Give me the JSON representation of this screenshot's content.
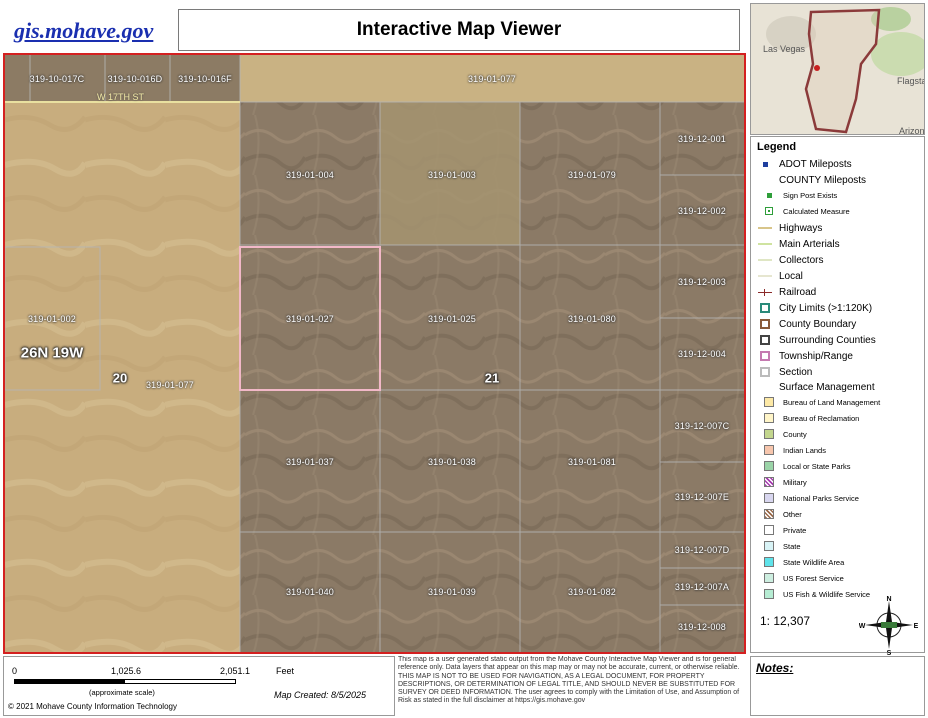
{
  "header": {
    "site_link": "gis.mohave.gov",
    "title": "Interactive Map Viewer"
  },
  "map": {
    "parcels": [
      {
        "id": "319-10-017C"
      },
      {
        "id": "319-10-016D"
      },
      {
        "id": "319-10-016F"
      },
      {
        "id": "319-01-077"
      },
      {
        "id": "319-12-001"
      },
      {
        "id": "319-01-004"
      },
      {
        "id": "319-01-003"
      },
      {
        "id": "319-01-079"
      },
      {
        "id": "319-12-002"
      },
      {
        "id": "319-12-003"
      },
      {
        "id": "319-01-002"
      },
      {
        "id": "319-01-027"
      },
      {
        "id": "319-01-025"
      },
      {
        "id": "319-01-080"
      },
      {
        "id": "319-12-004"
      },
      {
        "id": "319-01-077"
      },
      {
        "id": "319-12-007C"
      },
      {
        "id": "319-01-037"
      },
      {
        "id": "319-01-038"
      },
      {
        "id": "319-01-081"
      },
      {
        "id": "319-12-007E"
      },
      {
        "id": "319-12-007D"
      },
      {
        "id": "319-01-040"
      },
      {
        "id": "319-01-039"
      },
      {
        "id": "319-01-082"
      },
      {
        "id": "319-12-007A"
      },
      {
        "id": "319-12-008"
      }
    ],
    "street": "W 17TH ST",
    "township": "26N 19W",
    "sections": [
      "20",
      "21"
    ]
  },
  "overview": {
    "labels": [
      "Las Vegas",
      "Flagsta",
      "Arizon"
    ]
  },
  "legend": {
    "title": "Legend",
    "items": [
      {
        "label": "ADOT Mileposts",
        "size": "normal",
        "symbol": "dot",
        "color": "#1f3f9f"
      },
      {
        "label": "COUNTY Mileposts",
        "size": "normal",
        "symbol": "none",
        "color": ""
      },
      {
        "label": "Sign Post Exists",
        "size": "small",
        "symbol": "dot",
        "color": "#2e9e3a"
      },
      {
        "label": "Calculated Measure",
        "size": "small",
        "symbol": "dotbox",
        "color": "#2e9e3a"
      },
      {
        "label": "Highways",
        "size": "normal",
        "symbol": "line",
        "color": "#d8c58a"
      },
      {
        "label": "Main Arterials",
        "size": "normal",
        "symbol": "line",
        "color": "#cfe3a0"
      },
      {
        "label": "Collectors",
        "size": "normal",
        "symbol": "line",
        "color": "#dfe6c4"
      },
      {
        "label": "Local",
        "size": "normal",
        "symbol": "line",
        "color": "#e6e6d0"
      },
      {
        "label": "Railroad",
        "size": "normal",
        "symbol": "rail",
        "color": "#8b2a2a"
      },
      {
        "label": "City Limits (>1:120K)",
        "size": "normal",
        "symbol": "box",
        "color": "#2a8a7a"
      },
      {
        "label": "County Boundary",
        "size": "normal",
        "symbol": "box",
        "color": "#8a5a3a"
      },
      {
        "label": "Surrounding Counties",
        "size": "normal",
        "symbol": "box",
        "color": "#444444"
      },
      {
        "label": "Township/Range",
        "size": "normal",
        "symbol": "box",
        "color": "#c57ab0"
      },
      {
        "label": "Section",
        "size": "normal",
        "symbol": "box",
        "color": "#bbbbbb"
      },
      {
        "label": "Surface Management",
        "size": "normal",
        "symbol": "none",
        "color": ""
      },
      {
        "label": "Bureau of Land Management",
        "size": "small",
        "symbol": "swatch",
        "color": "#fde9a6"
      },
      {
        "label": "Bureau of Reclamation",
        "size": "small",
        "symbol": "swatch",
        "color": "#fff5c8"
      },
      {
        "label": "County",
        "size": "small",
        "symbol": "swatch",
        "color": "#c3d68e"
      },
      {
        "label": "Indian Lands",
        "size": "small",
        "symbol": "swatch",
        "color": "#f7c6ad"
      },
      {
        "label": "Local or State Parks",
        "size": "small",
        "symbol": "swatch",
        "color": "#9bd4a8"
      },
      {
        "label": "Military",
        "size": "small",
        "symbol": "hatch",
        "color": "#a73ab0"
      },
      {
        "label": "National Parks Service",
        "size": "small",
        "symbol": "swatch",
        "color": "#d8d6ef"
      },
      {
        "label": "Other",
        "size": "small",
        "symbol": "hatch",
        "color": "#9a6a4a"
      },
      {
        "label": "Private",
        "size": "small",
        "symbol": "swatch",
        "color": "#ffffff"
      },
      {
        "label": "State",
        "size": "small",
        "symbol": "swatch",
        "color": "#d8f3f6"
      },
      {
        "label": "State Wildlife Area",
        "size": "small",
        "symbol": "swatch",
        "color": "#5fe3ea"
      },
      {
        "label": "US Forest Service",
        "size": "small",
        "symbol": "swatch",
        "color": "#cdeee0"
      },
      {
        "label": "US Fish & Wildlife Service",
        "size": "small",
        "symbol": "swatch",
        "color": "#b6ecd3"
      }
    ],
    "scale": "1: 12,307",
    "compass": {
      "n": "N",
      "s": "S",
      "e": "E",
      "w": "W"
    }
  },
  "scalebar": {
    "ticks": [
      "0",
      "1,025.6",
      "2,051.1"
    ],
    "unit": "Feet",
    "note": "(approximate scale)",
    "copyright": "© 2021 Mohave County Information Technology",
    "map_created": "Map Created: 8/5/2025"
  },
  "disclaimer": "This map is a user generated static output from the Mohave County Interactive Map Viewer and is for general reference only. Data layers that appear on this map may or may not be accurate, current, or otherwise reliable. THIS MAP IS NOT TO BE USED FOR NAVIGATION, AS A LEGAL DOCUMENT, FOR PROPERTY DESCRIPTIONS, OR DETERMINATION OF LEGAL TITLE, AND SHOULD NEVER BE SUBSTITUTED FOR SURVEY OR DEED INFORMATION. The user agrees to comply with the Limitation of Use, and Assumption of Risk as stated in the full disclaimer at https://gis.mohave.gov",
  "notes": {
    "label": "Notes:"
  }
}
